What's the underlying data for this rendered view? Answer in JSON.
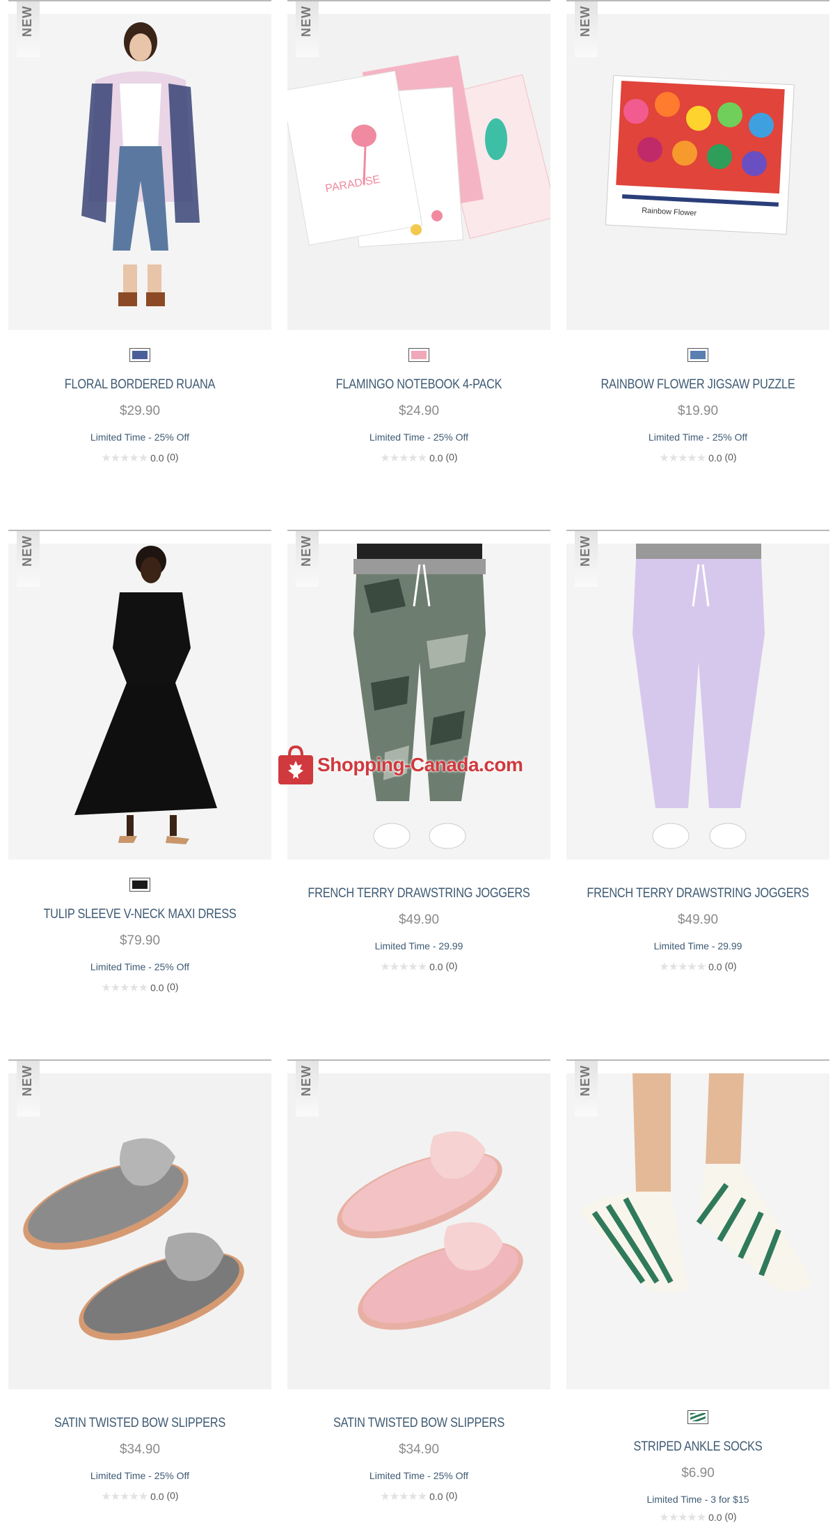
{
  "badge_label": "NEW",
  "watermark": {
    "text": "Shopping-Canada.com"
  },
  "products": [
    {
      "name": "FLORAL BORDERED RUANA",
      "price": "$29.90",
      "promo": "Limited Time - 25% Off",
      "rating": "0.0",
      "count": "(0)",
      "stars": "★★★★★",
      "swatch": "floral-swatch",
      "swatch_color": "#4a5f9a"
    },
    {
      "name": "FLAMINGO NOTEBOOK 4-PACK",
      "price": "$24.90",
      "promo": "Limited Time - 25% Off",
      "rating": "0.0",
      "count": "(0)",
      "stars": "★★★★★",
      "swatch": "flamingo-swatch",
      "swatch_color": "#f0a8b8"
    },
    {
      "name": "RAINBOW FLOWER JIGSAW PUZZLE",
      "price": "$19.90",
      "promo": "Limited Time - 25% Off",
      "rating": "0.0",
      "count": "(0)",
      "stars": "★★★★★",
      "swatch": "puzzle-swatch",
      "swatch_color": "#5a7fb0"
    },
    {
      "name": "TULIP SLEEVE V-NECK MAXI DRESS",
      "price": "$79.90",
      "promo": "Limited Time - 25% Off",
      "rating": "0.0",
      "count": "(0)",
      "stars": "★★★★★",
      "swatch": "black-swatch",
      "swatch_color": "#1a1a1a"
    },
    {
      "name": "FRENCH TERRY DRAWSTRING JOGGERS",
      "price": "$49.90",
      "promo": "Limited Time - 29.99",
      "rating": "0.0",
      "count": "(0)",
      "stars": "★★★★★"
    },
    {
      "name": "FRENCH TERRY DRAWSTRING JOGGERS",
      "price": "$49.90",
      "promo": "Limited Time - 29.99",
      "rating": "0.0",
      "count": "(0)",
      "stars": "★★★★★"
    },
    {
      "name": "SATIN TWISTED BOW SLIPPERS",
      "price": "$34.90",
      "promo": "Limited Time - 25% Off",
      "rating": "0.0",
      "count": "(0)",
      "stars": "★★★★★"
    },
    {
      "name": "SATIN TWISTED BOW SLIPPERS",
      "price": "$34.90",
      "promo": "Limited Time - 25% Off",
      "rating": "0.0",
      "count": "(0)",
      "stars": "★★★★★"
    },
    {
      "name": "STRIPED ANKLE SOCKS",
      "price": "$6.90",
      "promo": "Limited Time - 3 for $15",
      "rating": "0.0",
      "count": "(0)",
      "stars": "★★★★★",
      "swatch": "striped-swatch",
      "swatch_color": "#2f7a5a"
    }
  ],
  "colors": {
    "name_text": "#3e5a73",
    "price_text": "#8a8a8a",
    "watermark": "#d0393d",
    "star_empty": "#e2e2e2"
  }
}
